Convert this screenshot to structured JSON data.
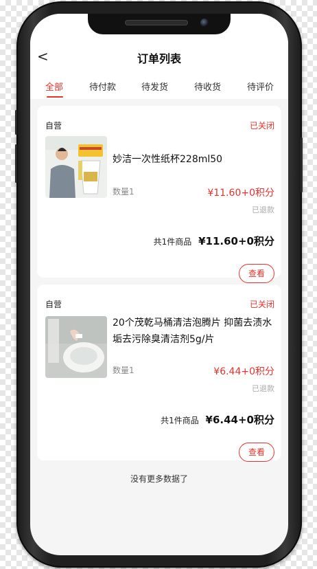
{
  "header": {
    "back_glyph": "<",
    "title": "订单列表"
  },
  "tabs": [
    {
      "label": "全部"
    },
    {
      "label": "待付款"
    },
    {
      "label": "待发货"
    },
    {
      "label": "待收货"
    },
    {
      "label": "待评价"
    }
  ],
  "active_tab_index": 0,
  "orders": [
    {
      "store": "自营",
      "status": "已关闭",
      "product_name": "妙洁一次性纸杯228ml50",
      "quantity": "数量1",
      "price": "¥11.60+0积分",
      "refund_status": "已退款",
      "summary_count": "共1件商品",
      "summary_total": "¥11.60+0积分",
      "view_button": "查看"
    },
    {
      "store": "自营",
      "status": "已关闭",
      "product_name": "20个茂乾马桶清洁泡腾片 抑菌去渍水垢去污除臭清洁剂5g/片",
      "quantity": "数量1",
      "price": "¥6.44+0积分",
      "refund_status": "已退款",
      "summary_count": "共1件商品",
      "summary_total": "¥6.44+0积分",
      "view_button": "查看"
    }
  ],
  "footer": {
    "no_more": "没有更多数据了"
  },
  "colors": {
    "accent": "#e5322d",
    "background": "#f5f5f5",
    "card": "#ffffff",
    "muted": "#888888"
  }
}
